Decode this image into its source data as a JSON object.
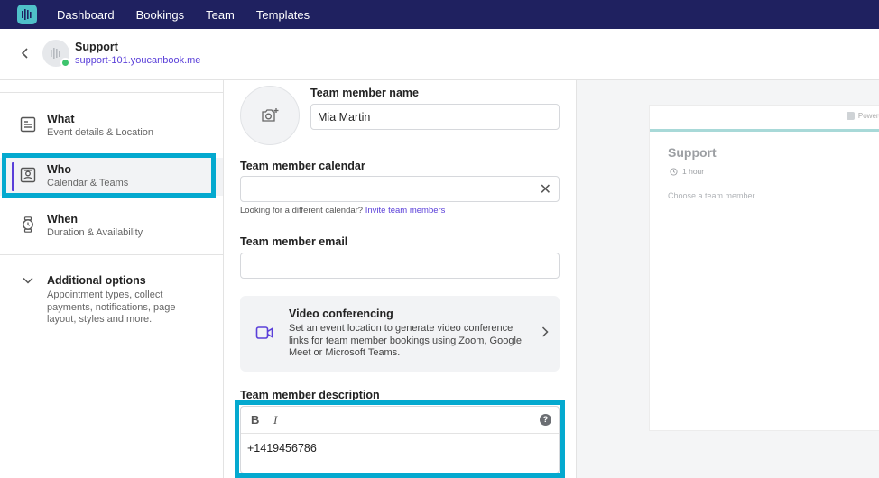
{
  "nav": {
    "items": [
      "Dashboard",
      "Bookings",
      "Team",
      "Templates"
    ]
  },
  "header": {
    "title": "Support",
    "subtitle": "support-101.youcanbook.me"
  },
  "sidebar": {
    "items": [
      {
        "title": "What",
        "subtitle": "Event details & Location"
      },
      {
        "title": "Who",
        "subtitle": "Calendar & Teams"
      },
      {
        "title": "When",
        "subtitle": "Duration & Availability"
      }
    ],
    "additional": {
      "title": "Additional options",
      "subtitle": "Appointment types, collect payments, notifications, page layout, styles and more."
    }
  },
  "form": {
    "name_label": "Team member name",
    "name_value": "Mia Martin",
    "calendar_label": "Team member calendar",
    "calendar_value": "",
    "calendar_hint": "Looking for a different calendar?",
    "calendar_hint_link": "Invite team members",
    "email_label": "Team member email",
    "email_value": "",
    "video": {
      "title": "Video conferencing",
      "description": "Set an event location to generate video conference links for team member bookings using Zoom, Google Meet or Microsoft Teams."
    },
    "description_label": "Team member description",
    "description_value": "+1419456786",
    "toolbar": {
      "bold": "B",
      "italic": "I",
      "help": "?"
    }
  },
  "preview": {
    "powered": "Powere",
    "title": "Support",
    "duration": "1 hour",
    "choose": "Choose a team member."
  },
  "colors": {
    "nav_bg": "#1f2160",
    "accent": "#5a3fd9",
    "highlight": "#04a9cf",
    "logo": "#4fc1c9"
  }
}
